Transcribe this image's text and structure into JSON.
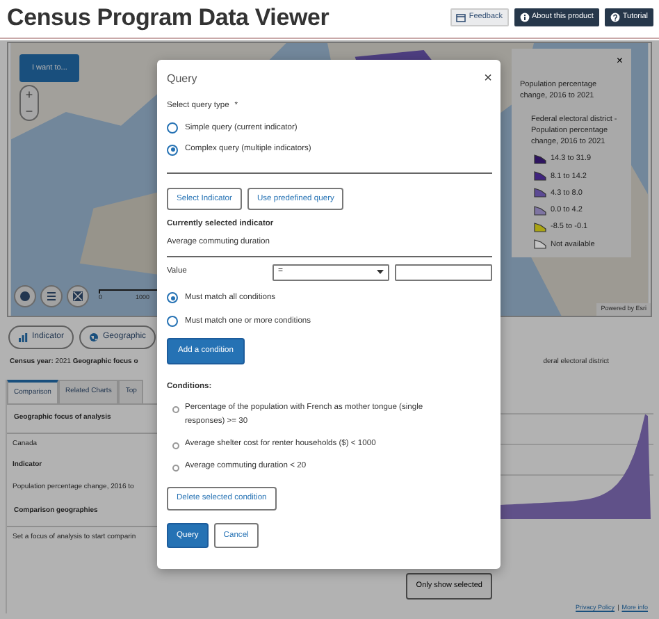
{
  "header": {
    "title": "Census Program Data Viewer",
    "buttons": [
      {
        "label": "Feedback",
        "kind": "outline"
      },
      {
        "label": "About this product",
        "kind": "dark"
      },
      {
        "label": "Tutorial",
        "kind": "dark"
      }
    ]
  },
  "map": {
    "menu_button": "I want to...",
    "zoom_in": "+",
    "zoom_out": "−",
    "scale_labels": [
      "0",
      "1000"
    ],
    "attribution": "Powered by Esri",
    "legend": {
      "close": "×",
      "title": "Population percentage change, 2016 to 2021",
      "layer": "Federal electoral district - Population percentage change, 2016 to 2021",
      "items": [
        {
          "label": "14.3 to 31.9",
          "color": "#2e1460"
        },
        {
          "label": "8.1 to 14.2",
          "color": "#40247e"
        },
        {
          "label": "4.3 to 8.0",
          "color": "#5c4a94"
        },
        {
          "label": "0.0 to 4.2",
          "color": "#7e74a2"
        },
        {
          "label": "-8.5 to -0.1",
          "color": "#aaa414"
        },
        {
          "label": "Not available",
          "color": "#c4c4c4"
        }
      ]
    }
  },
  "toolbar": {
    "buttons": [
      {
        "label": "Indicator"
      },
      {
        "label": "Geographic"
      }
    ]
  },
  "summary": {
    "left": "**Census year:** 2021 **Geographic focus o**",
    "right": "deral electoral district"
  },
  "panel": {
    "tabs": [
      {
        "label": "Comparison",
        "selected": true
      },
      {
        "label": "Related Charts",
        "selected": false
      },
      {
        "label": "Top",
        "selected": false
      }
    ],
    "rows": [
      {
        "kind": "heading",
        "text": "Geographic focus of analysis"
      },
      {
        "kind": "value",
        "text": "Canada"
      },
      {
        "kind": "label",
        "text": "Indicator"
      },
      {
        "kind": "value",
        "text": "Population percentage change, 2016 to"
      },
      {
        "kind": "heading",
        "text": "Comparison geographies"
      },
      {
        "kind": "value",
        "text": "Set a focus of analysis to start comparin"
      }
    ]
  },
  "only_selected_button": "Only show selected",
  "footer": {
    "links": [
      "Privacy Policy",
      "More info"
    ],
    "separator": "|"
  },
  "modal": {
    "title": "Query",
    "close": "×",
    "query_type_label": "Select query type",
    "required_mark": "*",
    "query_types": [
      {
        "label": "Simple query (current indicator)",
        "selected": false
      },
      {
        "label": "Complex query (multiple indicators)",
        "selected": true
      }
    ],
    "indicator_buttons": [
      "Select Indicator",
      "Use predefined query"
    ],
    "current_indicator_label": "Currently selected indicator",
    "current_indicator": "Average commuting duration",
    "value_label": "Value",
    "operator": "=",
    "match_modes": [
      {
        "label": "Must match all conditions",
        "selected": true
      },
      {
        "label": "Must match one or more conditions",
        "selected": false
      }
    ],
    "add_button": "Add a condition",
    "conditions_label": "Conditions:",
    "conditions": [
      {
        "text": "Percentage of the population with French as mother tongue (single responses) >= 30",
        "selected": false
      },
      {
        "text": "Average shelter cost for renter households ($) < 1000",
        "selected": false
      },
      {
        "text": "Average commuting duration < 20",
        "selected": false
      }
    ],
    "delete_button": "Delete selected condition",
    "footer_buttons": [
      {
        "label": "Query",
        "kind": "primary"
      },
      {
        "label": "Cancel",
        "kind": "outline"
      }
    ]
  }
}
